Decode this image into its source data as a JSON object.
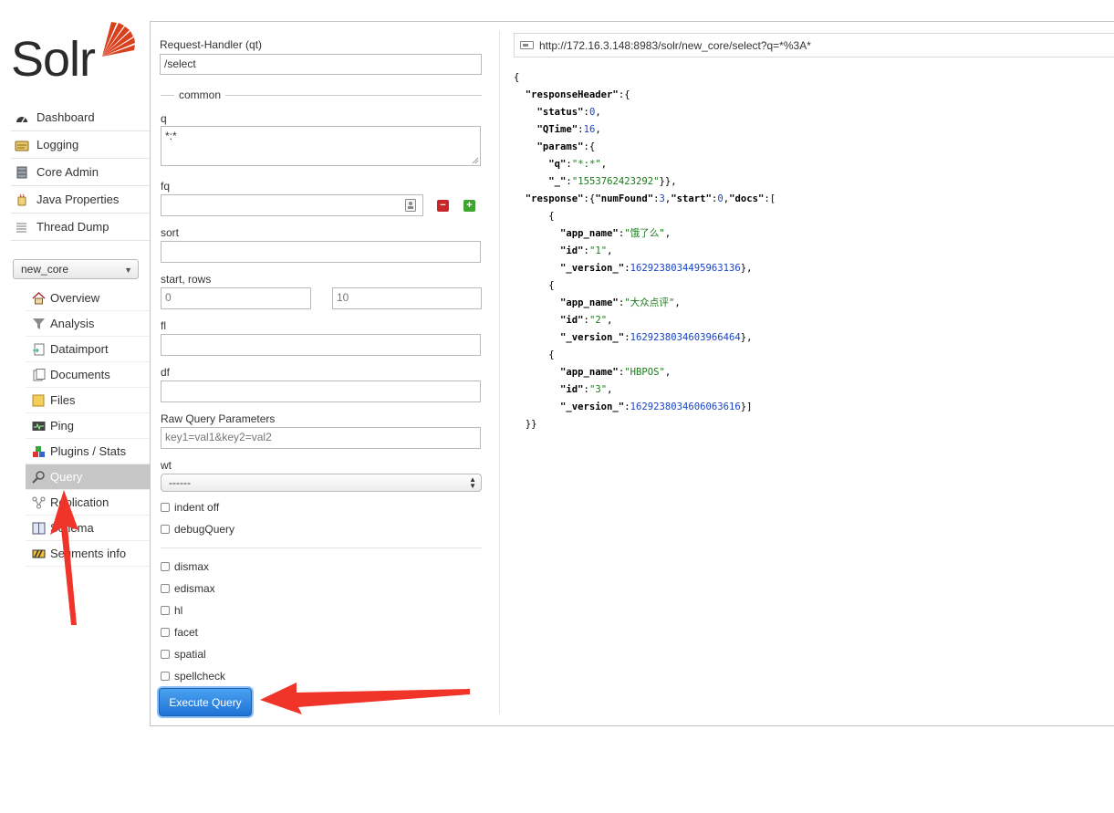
{
  "logo": {
    "text": "Solr"
  },
  "main_nav": [
    {
      "label": "Dashboard",
      "icon": "dashboard-icon"
    },
    {
      "label": "Logging",
      "icon": "logging-icon"
    },
    {
      "label": "Core Admin",
      "icon": "core-admin-icon"
    },
    {
      "label": "Java Properties",
      "icon": "java-icon"
    },
    {
      "label": "Thread Dump",
      "icon": "thread-dump-icon"
    }
  ],
  "core_selector": {
    "value": "new_core"
  },
  "core_nav": [
    {
      "label": "Overview",
      "icon": "home-icon"
    },
    {
      "label": "Analysis",
      "icon": "funnel-icon"
    },
    {
      "label": "Dataimport",
      "icon": "import-icon"
    },
    {
      "label": "Documents",
      "icon": "documents-icon"
    },
    {
      "label": "Files",
      "icon": "folder-icon"
    },
    {
      "label": "Ping",
      "icon": "ping-icon"
    },
    {
      "label": "Plugins / Stats",
      "icon": "plugins-icon"
    },
    {
      "label": "Query",
      "icon": "magnifier-icon",
      "active": true
    },
    {
      "label": "Replication",
      "icon": "replication-icon"
    },
    {
      "label": "Schema",
      "icon": "schema-icon"
    },
    {
      "label": "Segments info",
      "icon": "segments-icon"
    }
  ],
  "form": {
    "qt_label": "Request-Handler (qt)",
    "qt_value": "/select",
    "common_legend": "common",
    "q_label": "q",
    "q_value": "*:*",
    "fq_label": "fq",
    "fq_value": "",
    "sort_label": "sort",
    "sort_value": "",
    "start_rows_label": "start, rows",
    "start_value": "0",
    "rows_value": "10",
    "fl_label": "fl",
    "fl_value": "",
    "df_label": "df",
    "df_value": "",
    "raw_label": "Raw Query Parameters",
    "raw_placeholder": "key1=val1&key2=val2",
    "wt_label": "wt",
    "wt_value": "------",
    "checkboxes_top": [
      "indent off",
      "debugQuery"
    ],
    "checkboxes_bottom": [
      "dismax",
      "edismax",
      "hl",
      "facet",
      "spatial",
      "spellcheck"
    ],
    "execute_label": "Execute Query"
  },
  "result": {
    "url": "http://172.16.3.148:8983/solr/new_core/select?q=*%3A*",
    "lines": [
      "{",
      "  \"responseHeader\":{",
      "    \"status\":0,",
      "    \"QTime\":16,",
      "    \"params\":{",
      "      \"q\":\"*:*\",",
      "      \"_\":\"1553762423292\"}},",
      "  \"response\":{\"numFound\":3,\"start\":0,\"docs\":[",
      "      {",
      "        \"app_name\":\"饿了么\",",
      "        \"id\":\"1\",",
      "        \"_version_\":1629238034495963136},",
      "      {",
      "        \"app_name\":\"大众点评\",",
      "        \"id\":\"2\",",
      "        \"_version_\":1629238034603966464},",
      "      {",
      "        \"app_name\":\"HBPOS\",",
      "        \"id\":\"3\",",
      "        \"_version_\":1629238034606063616}]",
      "  }}"
    ]
  },
  "colors": {
    "annotation_arrow": "#f0342a",
    "json_number": "#1a43c8",
    "json_string": "#1b7a1b",
    "execute_button": "#2a7fe0"
  }
}
